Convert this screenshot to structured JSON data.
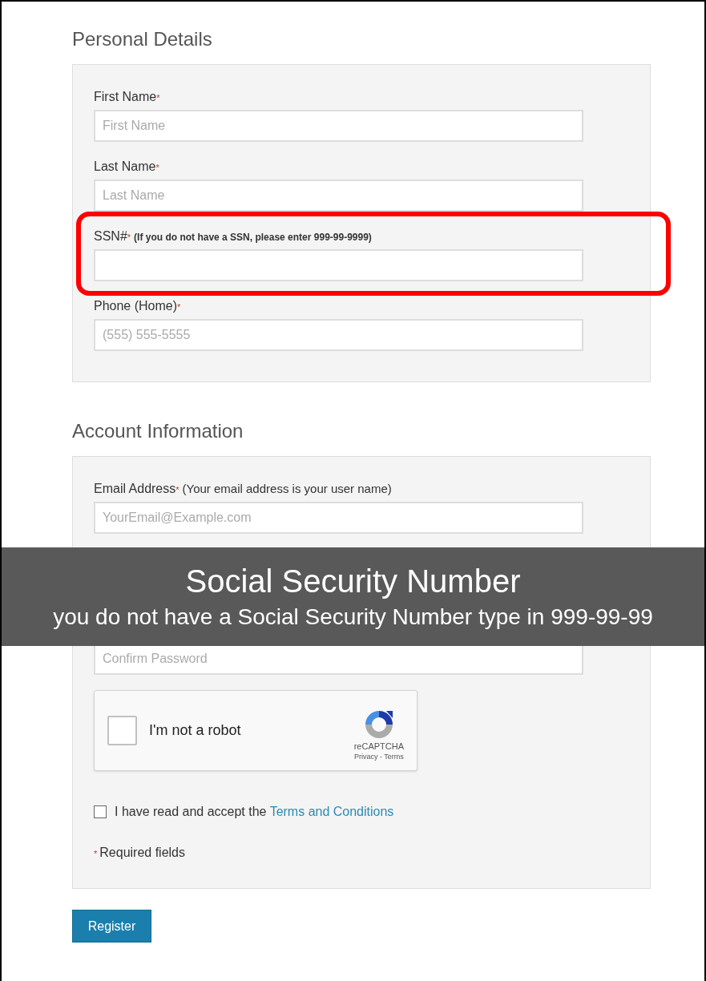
{
  "sections": [
    {
      "title": "Personal Details",
      "items": [
        {
          "kind": "input",
          "label": "First Name",
          "asterisk": "*",
          "placeholder": "First Name",
          "highlighted": false
        },
        {
          "kind": "input",
          "label": "Last Name",
          "asterisk": "*",
          "placeholder": "Last Name",
          "highlighted": false
        },
        {
          "kind": "input",
          "label": "SSN#",
          "asterisk": "*",
          "note": "(If you do not have a SSN, please enter 999-99-9999)",
          "note_bold": true,
          "highlighted": true
        },
        {
          "kind": "input",
          "label": "Phone (Home)",
          "asterisk": "*",
          "placeholder": "(555) 555-5555",
          "highlighted": false
        }
      ]
    },
    {
      "title": "Account Information",
      "items": [
        {
          "kind": "input",
          "label": "Email Address",
          "asterisk": "*",
          "note": "(Your email address is your user name)",
          "note_bold": false,
          "placeholder": "YourEmail@Example.com",
          "highlighted": false
        },
        {
          "kind": "covered"
        },
        {
          "kind": "bare_input",
          "placeholder": "Confirm Password"
        },
        {
          "kind": "captcha",
          "label": "I'm not a robot",
          "checked": false,
          "brand": "reCAPTCHA",
          "links": "Privacy - Terms"
        },
        {
          "kind": "checkbox",
          "text": "I have read and accept the",
          "link": "Terms and Conditions",
          "checked": false
        },
        {
          "kind": "legend",
          "asterisk": "*",
          "text": "Required fields"
        }
      ]
    }
  ],
  "button": "Register",
  "banner": {
    "title": "Social Security Number",
    "text": "you do not have a Social Security Number type in 999-99-99"
  }
}
